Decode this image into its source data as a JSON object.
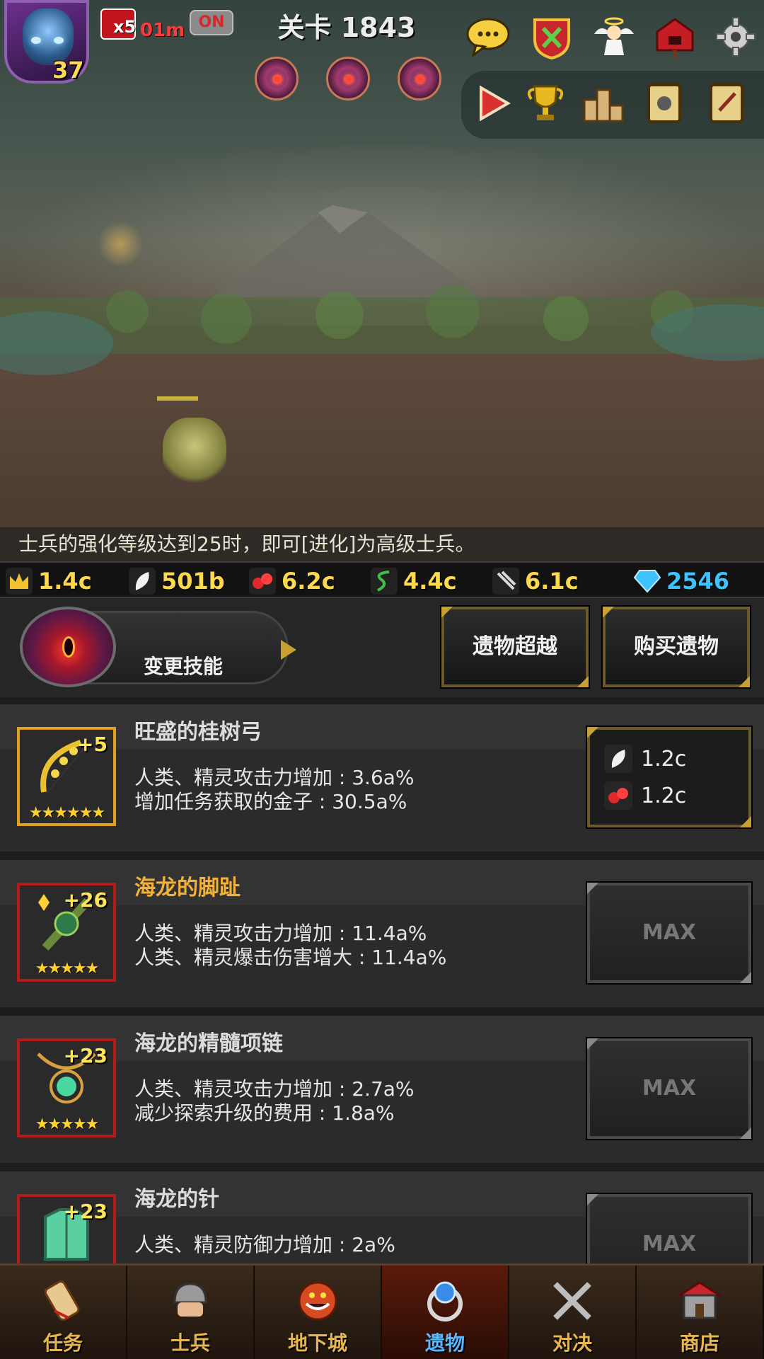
{
  "hud": {
    "player_level": "37",
    "boost_multiplier": "x5",
    "boost_time": "01m",
    "auto_toggle": "ON",
    "stage_title": "关卡 1843"
  },
  "top_icons": [
    "chat-icon",
    "guild-crest-icon",
    "angel-icon",
    "mailbox-icon",
    "gear-icon"
  ],
  "toolbar_icons": [
    "play-icon",
    "trophy-icon",
    "ranking-podium-icon",
    "skill-book-icon",
    "quest-book-icon"
  ],
  "tip": "士兵的强化等级达到25时，即可[进化]为高级士兵。",
  "currencies": [
    {
      "icon": "crown-icon",
      "value": "1.4c"
    },
    {
      "icon": "feather-icon",
      "value": "501b"
    },
    {
      "icon": "red-crystal-icon",
      "value": "6.2c"
    },
    {
      "icon": "green-vine-icon",
      "value": "4.4c"
    },
    {
      "icon": "claw-icon",
      "value": "6.1c"
    },
    {
      "icon": "diamond-icon",
      "value": "2546"
    }
  ],
  "actions": {
    "change_skill": "变更技能",
    "relic_transcend": "遗物超越",
    "buy_relic": "购买遗物"
  },
  "relics": [
    {
      "name": "旺盛的桂树弓",
      "plus": "+5",
      "stars": "★★★★★★",
      "stat1": "人类、精灵攻击力增加 : 3.6a%",
      "stat2": "增加任务获取的金子 : 30.5a%",
      "cost1": "1.2c",
      "cost2": "1.2c"
    },
    {
      "name": "海龙的脚趾",
      "plus": "+26",
      "stars": "★★★★★",
      "stat1": "人类、精灵攻击力增加 : 11.4a%",
      "stat2": "人类、精灵爆击伤害增大 : 11.4a%",
      "button": "MAX"
    },
    {
      "name": "海龙的精髓项链",
      "plus": "+23",
      "stars": "★★★★★",
      "stat1": "人类、精灵攻击力增加 : 2.7a%",
      "stat2": "减少探索升级的费用 : 1.8a%",
      "button": "MAX"
    },
    {
      "name": "海龙的针",
      "plus": "+23",
      "stars": "★★★★★",
      "stat1": "人类、精灵防御力增加 : 2a%",
      "stat2": "",
      "button": "MAX"
    }
  ],
  "nav": [
    {
      "label": "任务",
      "icon": "scroll-icon"
    },
    {
      "label": "士兵",
      "icon": "soldier-helmet-icon"
    },
    {
      "label": "地下城",
      "icon": "monster-plant-icon"
    },
    {
      "label": "遗物",
      "icon": "orb-ring-icon",
      "active": true
    },
    {
      "label": "对决",
      "icon": "crossed-swords-icon"
    },
    {
      "label": "商店",
      "icon": "shop-icon"
    }
  ]
}
